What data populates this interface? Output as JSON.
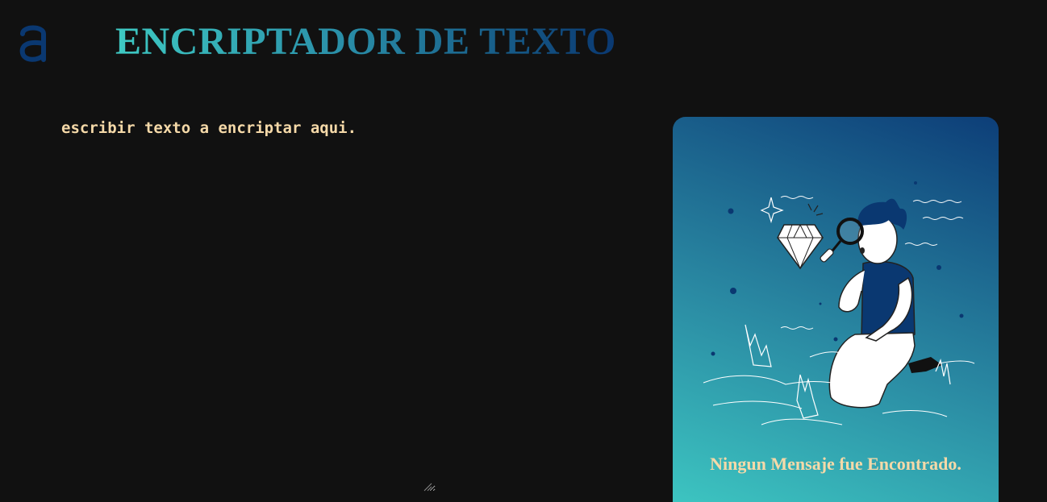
{
  "header": {
    "logo_letter": "a",
    "title": "ENCRIPTADOR DE TEXTO"
  },
  "input": {
    "placeholder": "escribir texto a encriptar aqui.",
    "value": ""
  },
  "output": {
    "empty_message": "Ningun Mensaje fue Encontrado.",
    "illustration": "person-with-magnifier-diamond-illustration"
  },
  "colors": {
    "background": "#111111",
    "accent_dark": "#0a3871",
    "accent_teal": "#3ec9c3",
    "text_cream": "#f5d9a8"
  }
}
